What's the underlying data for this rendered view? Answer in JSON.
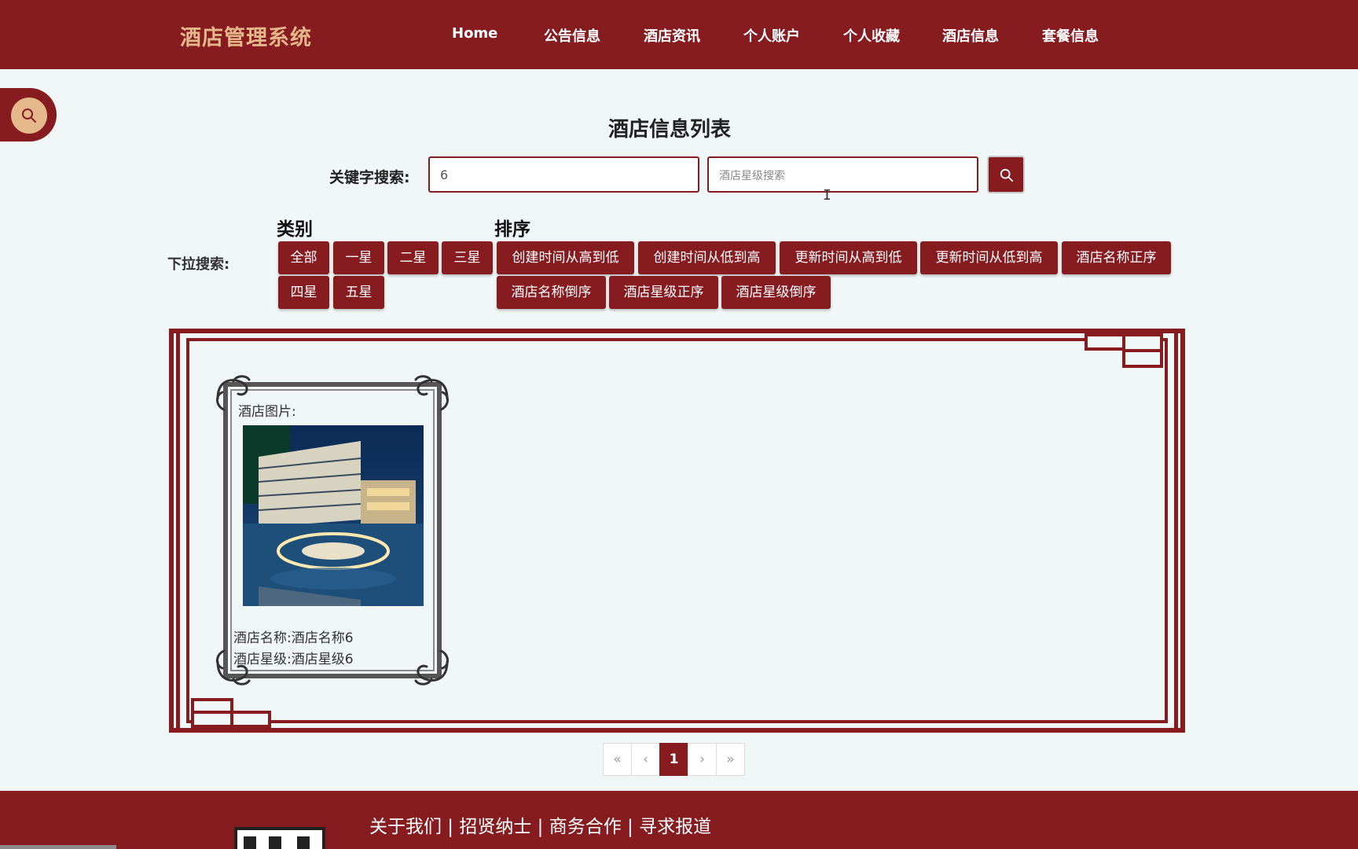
{
  "header": {
    "brand": "酒店管理系统",
    "nav": [
      {
        "id": "home",
        "label": "Home"
      },
      {
        "id": "notice",
        "label": "公告信息"
      },
      {
        "id": "news",
        "label": "酒店资讯"
      },
      {
        "id": "account",
        "label": "个人账户"
      },
      {
        "id": "favorites",
        "label": "个人收藏"
      },
      {
        "id": "hotel",
        "label": "酒店信息"
      },
      {
        "id": "package",
        "label": "套餐信息"
      }
    ]
  },
  "page": {
    "title": "酒店信息列表",
    "keyword_label": "关键字搜索:",
    "keyword_value": "6",
    "star_placeholder": "酒店星级搜索"
  },
  "filters": {
    "dropdown_label": "下拉搜索:",
    "category_title": "类别",
    "sort_title": "排序",
    "categories": [
      "全部",
      "一星",
      "二星",
      "三星",
      "四星",
      "五星"
    ],
    "sorts": [
      "创建时间从高到低",
      "创建时间从低到高",
      "更新时间从高到低",
      "更新时间从低到高",
      "酒店名称正序",
      "酒店名称倒序",
      "酒店星级正序",
      "酒店星级倒序"
    ]
  },
  "results": [
    {
      "image_label": "酒店图片:",
      "name_line": "酒店名称:酒店名称6",
      "star_line": "酒店星级:酒店星级6"
    }
  ],
  "pagination": {
    "first": "«",
    "prev": "‹",
    "current": "1",
    "next": "›",
    "last": "»"
  },
  "footer": {
    "links": [
      "关于我们",
      "招贤纳士",
      "商务合作",
      "寻求报道"
    ],
    "separator": " | "
  },
  "colors": {
    "primary": "#861b20",
    "accent": "#e4b88a",
    "background": "#f1f6f7"
  },
  "icons": {
    "side_tab": "search-icon",
    "search_button": "search-icon"
  }
}
